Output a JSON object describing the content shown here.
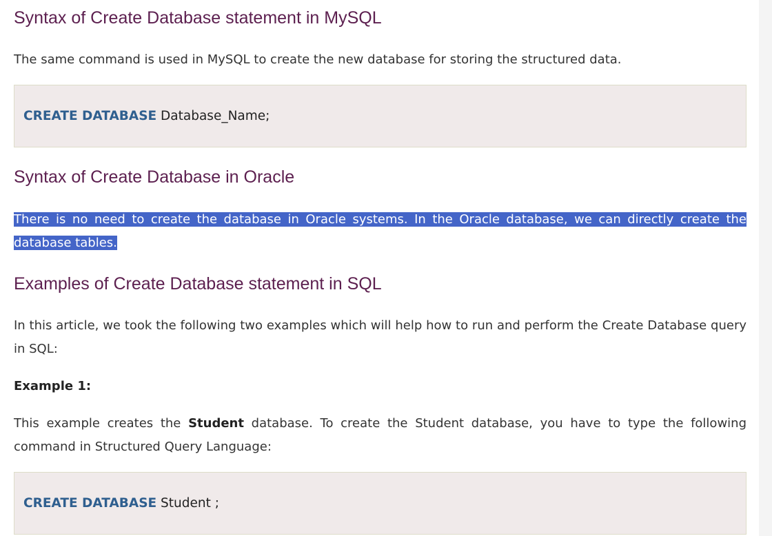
{
  "sections": {
    "mysql": {
      "heading": "Syntax of Create Database statement in MySQL",
      "paragraph": "The same command is used in MySQL to create the new database for storing the structured data.",
      "code": {
        "keyword": "CREATE DATABASE",
        "rest": " Database_Name;"
      }
    },
    "oracle": {
      "heading": "Syntax of Create Database in Oracle",
      "paragraph": "There is no need to create the database in Oracle systems. In the Oracle database, we can directly create the database tables."
    },
    "examples": {
      "heading": "Examples of Create Database statement in SQL",
      "paragraph": "In this article, we took the following two examples which will help how to run and perform the Create Database query in SQL:",
      "example1_label": "Example 1:",
      "example1_text_before": "This example creates the ",
      "example1_text_bold": "Student",
      "example1_text_after": " database. To create the Student database, you have to type the following command in Structured Query Language:",
      "code": {
        "keyword": "CREATE DATABASE",
        "rest": " Student ;"
      }
    }
  },
  "colors": {
    "heading": "#5c1f4f",
    "code_keyword": "#2f5f8f",
    "code_background": "#f0eaea",
    "selection_highlight": "#4465c8"
  }
}
